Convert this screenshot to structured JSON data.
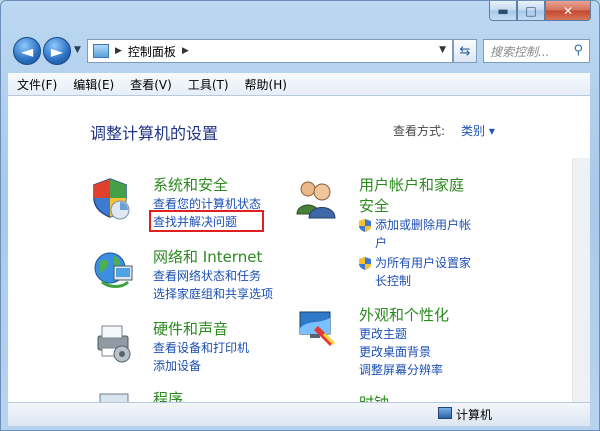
{
  "window": {
    "caption_buttons": {
      "minimize": "▬",
      "maximize": "□",
      "close": "✕"
    }
  },
  "nav": {
    "breadcrumb": [
      "控制面板"
    ],
    "search_placeholder": "搜索控制..."
  },
  "menu": [
    "文件(F)",
    "编辑(E)",
    "查看(V)",
    "工具(T)",
    "帮助(H)"
  ],
  "content": {
    "title": "调整计算机的设置",
    "view_by_label": "查看方式:",
    "view_by_value": "类别 ▾",
    "categories": {
      "system_security": {
        "title": "系统和安全",
        "links": [
          "查看您的计算机状态",
          "查找并解决问题"
        ]
      },
      "network": {
        "title": "网络和 Internet",
        "links": [
          "查看网络状态和任务",
          "选择家庭组和共享选项"
        ]
      },
      "hardware": {
        "title": "硬件和声音",
        "links": [
          "查看设备和打印机",
          "添加设备"
        ]
      },
      "programs": {
        "title": "程序"
      },
      "user_accounts": {
        "title_line1": "用户帐户和家庭",
        "title_line2": "安全",
        "links": [
          "添加或删除用户帐",
          "户",
          "为所有用户设置家",
          "长控制"
        ]
      },
      "appearance": {
        "title": "外观和个性化",
        "links": [
          "更改主题",
          "更改桌面背景",
          "调整屏幕分辨率"
        ]
      },
      "clock_partial": {
        "title": "时钟"
      }
    }
  },
  "status": {
    "computer": "计算机"
  },
  "colors": {
    "link": "#1c4fb4",
    "category": "#2a8a1e",
    "title": "#1e3287",
    "highlight": "#e02020"
  }
}
